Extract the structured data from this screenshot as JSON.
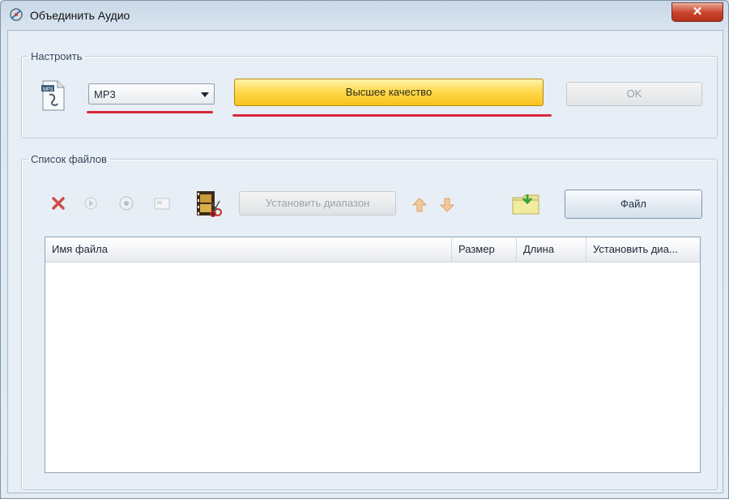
{
  "window": {
    "title": "Объединить Аудио",
    "close_label": "✕"
  },
  "settings": {
    "legend": "Настроить",
    "format_value": "MP3",
    "quality_label": "Высшее качество",
    "ok_label": "OK"
  },
  "files": {
    "legend": "Список файлов",
    "trim_label": "Установить диапазон",
    "file_label": "Файл",
    "columns": [
      "Имя файла",
      "Размер",
      "Длина",
      "Установить диа..."
    ]
  },
  "colors": {
    "highlight_underline": "#d9273b",
    "quality_button": "#ffd84a"
  },
  "icons": {
    "toolbar": [
      "delete-icon",
      "play-icon",
      "stop-icon",
      "info-icon",
      "film-cut-icon",
      "move-up-icon",
      "move-down-icon",
      "add-folder-icon"
    ]
  }
}
